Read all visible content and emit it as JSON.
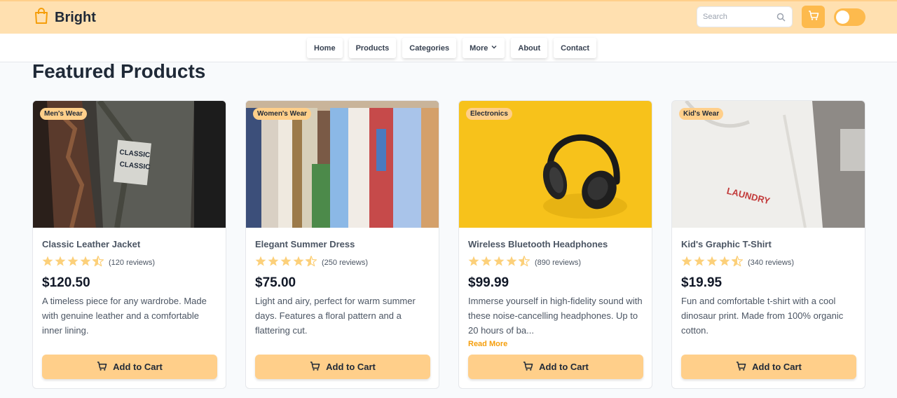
{
  "brand": {
    "name": "Bright",
    "icon": "shopping-bag-icon",
    "accent": "#fdba4d"
  },
  "header": {
    "search_placeholder": "Search"
  },
  "nav": {
    "items": [
      "Home",
      "Products",
      "Categories",
      "More",
      "About",
      "Contact"
    ]
  },
  "main": {
    "title": "Featured Products",
    "products": [
      {
        "category": "Men's Wear",
        "name": "Classic Leather Jacket",
        "rating": 4.5,
        "reviews": "(120 reviews)",
        "price": "$120.50",
        "description": "A timeless piece for any wardrobe. Made with genuine leather and a comfortable inner lining.",
        "button": "Add to Cart"
      },
      {
        "category": "Women's Wear",
        "name": "Elegant Summer Dress",
        "rating": 4.5,
        "reviews": "(250 reviews)",
        "price": "$75.00",
        "description": "Light and airy, perfect for warm summer days. Features a floral pattern and a flattering cut.",
        "button": "Add to Cart"
      },
      {
        "category": "Electronics",
        "name": "Wireless Bluetooth Headphones",
        "rating": 4.5,
        "reviews": "(890 reviews)",
        "price": "$99.99",
        "description": "Immerse yourself in high-fidelity sound with these noise-cancelling headphones. Up to 20 hours of ba...",
        "read_more": "Read More",
        "button": "Add to Cart"
      },
      {
        "category": "Kid's Wear",
        "name": "Kid's Graphic T-Shirt",
        "rating": 4.5,
        "reviews": "(340 reviews)",
        "price": "$19.95",
        "description": "Fun and comfortable t-shirt with a cool dinosaur print. Made from 100% organic cotton.",
        "button": "Add to Cart"
      }
    ]
  },
  "image_text": {
    "jacket_patch": "CLASSIC",
    "tshirt_print": "LAUNDRY"
  }
}
